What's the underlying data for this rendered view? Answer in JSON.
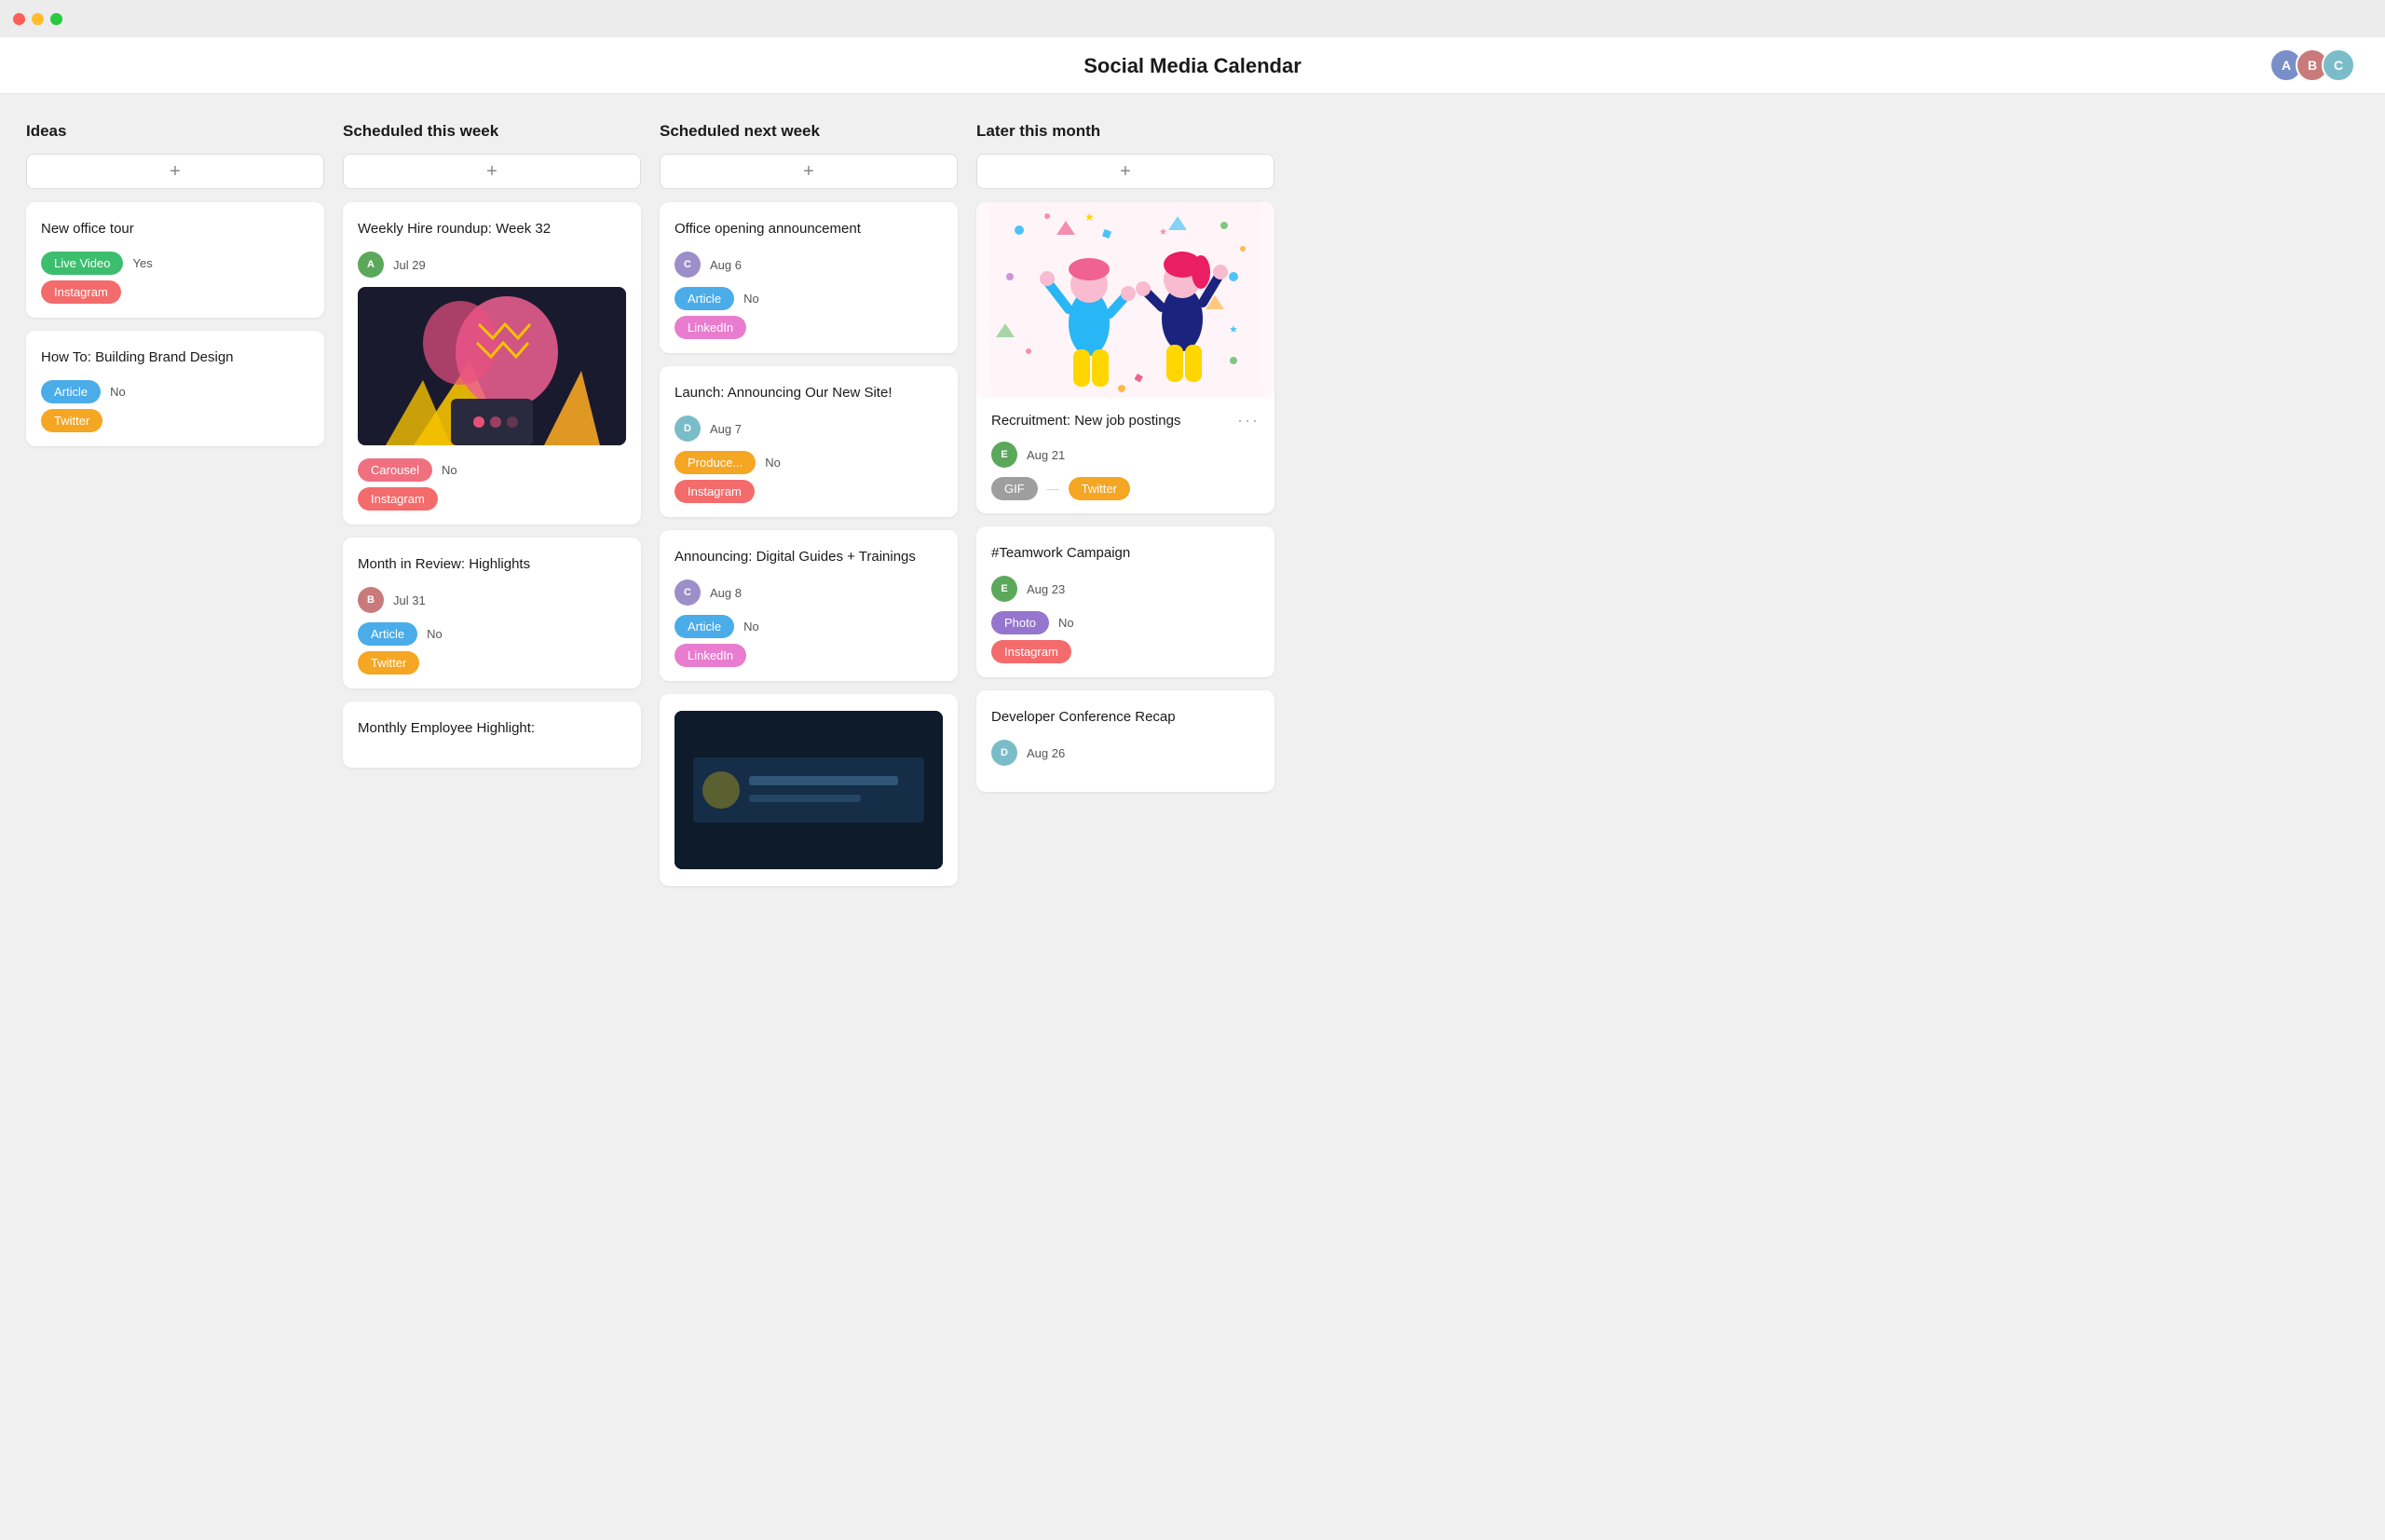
{
  "app": {
    "title": "Social Media Calendar"
  },
  "avatars": [
    {
      "id": "av1",
      "initials": "A",
      "color": "#7a8fc9"
    },
    {
      "id": "av2",
      "initials": "B",
      "color": "#c97a7a"
    },
    {
      "id": "av3",
      "initials": "C",
      "color": "#7abdc9"
    }
  ],
  "columns": [
    {
      "id": "ideas",
      "title": "Ideas",
      "add_label": "+",
      "cards": [
        {
          "id": "new-office-tour",
          "title": "New office tour",
          "type_tag": "Live Video",
          "type_tag_color": "tag-green",
          "approved": "Yes",
          "platform_tag": "Instagram",
          "platform_tag_color": "tag-coral"
        },
        {
          "id": "brand-design",
          "title": "How To: Building Brand Design",
          "type_tag": "Article",
          "type_tag_color": "tag-blue",
          "approved": "No",
          "platform_tag": "Twitter",
          "platform_tag_color": "tag-orange"
        }
      ]
    },
    {
      "id": "scheduled-this-week",
      "title": "Scheduled this week",
      "add_label": "+",
      "cards": [
        {
          "id": "weekly-hire",
          "title": "Weekly Hire roundup: Week 32",
          "has_avatar": true,
          "avatar_color": "ca1",
          "date": "Jul 29",
          "type_tag": "Carousel",
          "type_tag_color": "tag-pink",
          "approved": "No",
          "platform_tag": "Instagram",
          "platform_tag_color": "tag-coral",
          "has_image": true,
          "image_type": "colorful"
        },
        {
          "id": "month-review",
          "title": "Month in Review: Highlights",
          "has_avatar": true,
          "avatar_color": "ca2",
          "date": "Jul 31",
          "type_tag": "Article",
          "type_tag_color": "tag-blue",
          "approved": "No",
          "platform_tag": "Twitter",
          "platform_tag_color": "tag-orange"
        },
        {
          "id": "monthly-employee",
          "title": "Monthly Employee Highlight:",
          "has_avatar": false,
          "date": "",
          "type_tag": "",
          "approved": "",
          "platform_tag": ""
        }
      ]
    },
    {
      "id": "scheduled-next-week",
      "title": "Scheduled next week",
      "add_label": "+",
      "cards": [
        {
          "id": "office-opening",
          "title": "Office opening announcement",
          "has_avatar": true,
          "avatar_color": "ca3",
          "date": "Aug 6",
          "type_tag": "Article",
          "type_tag_color": "tag-teal",
          "approved": "No",
          "platform_tag": "LinkedIn",
          "platform_tag_color": "tag-linkedin"
        },
        {
          "id": "launch-new-site",
          "title": "Launch: Announcing Our New Site!",
          "has_avatar": true,
          "avatar_color": "ca4",
          "date": "Aug 7",
          "type_tag": "Produce...",
          "type_tag_color": "tag-produce",
          "approved": "No",
          "platform_tag": "Instagram",
          "platform_tag_color": "tag-coral"
        },
        {
          "id": "digital-guides",
          "title": "Announcing: Digital Guides + Trainings",
          "has_avatar": true,
          "avatar_color": "ca3",
          "date": "Aug 8",
          "type_tag": "Article",
          "type_tag_color": "tag-blue",
          "approved": "No",
          "platform_tag": "LinkedIn",
          "platform_tag_color": "tag-linkedin"
        }
      ]
    },
    {
      "id": "later-this-month",
      "title": "Later this month",
      "add_label": "+",
      "cards": [
        {
          "id": "recruitment",
          "title": "Recruitment: New job postings",
          "has_avatar": true,
          "avatar_color": "ca5",
          "date": "Aug 21",
          "type_tag": "GIF",
          "type_tag_color": "tag-gray",
          "dash": "—",
          "platform_tag": "Twitter",
          "platform_tag_color": "tag-orange",
          "has_celebration": true
        },
        {
          "id": "teamwork",
          "title": "#Teamwork Campaign",
          "has_avatar": true,
          "avatar_color": "ca5",
          "date": "Aug 23",
          "type_tag": "Photo",
          "type_tag_color": "tag-photo",
          "approved": "No",
          "platform_tag": "Instagram",
          "platform_tag_color": "tag-coral"
        },
        {
          "id": "dev-conference",
          "title": "Developer Conference Recap",
          "has_avatar": true,
          "avatar_color": "ca4",
          "date": "Aug 26",
          "type_tag": "",
          "platform_tag": ""
        }
      ]
    }
  ]
}
